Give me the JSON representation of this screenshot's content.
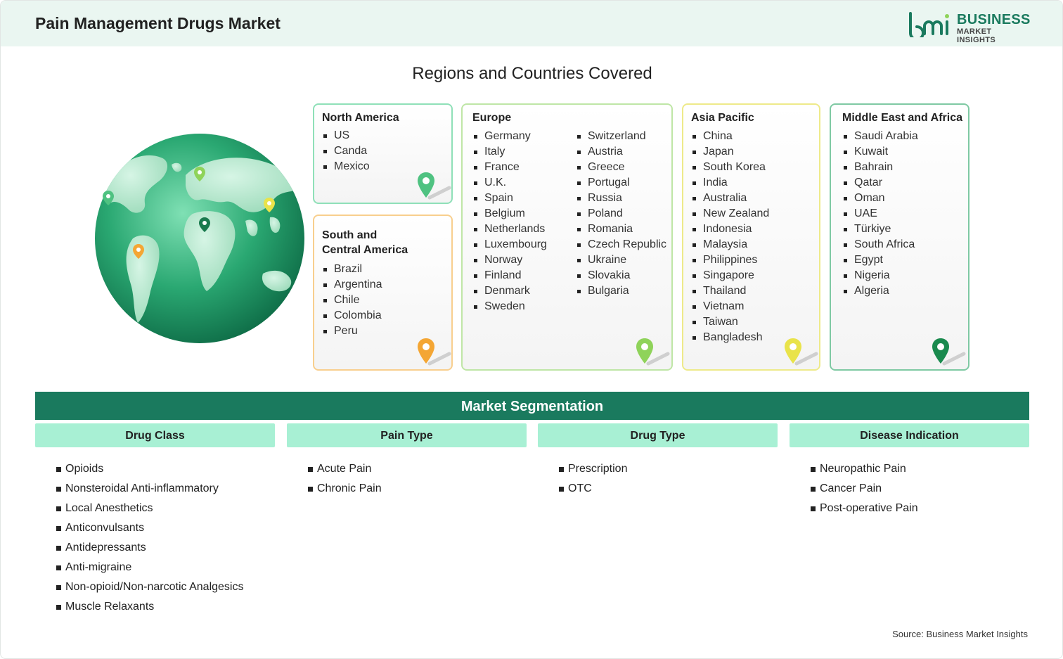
{
  "header": {
    "title": "Pain Management Drugs Market",
    "logo_word1": "BUSINESS",
    "logo_word2": "MARKET INSIGHTS",
    "logo_mark": "bmi"
  },
  "regions": {
    "title": "Regions and Countries Covered",
    "north_america": {
      "title": "North America",
      "color": "#4fc281",
      "items": [
        "US",
        "Canda",
        "Mexico"
      ]
    },
    "south_america": {
      "title_line1": "South and",
      "title_line2": "Central America",
      "color": "#f4a634",
      "items": [
        "Brazil",
        "Argentina",
        "Chile",
        "Colombia",
        "Peru"
      ]
    },
    "europe": {
      "title": "Europe",
      "color": "#8fd35a",
      "col1": [
        "Germany",
        "Italy",
        "France",
        "U.K.",
        "Spain",
        "Belgium",
        "Netherlands",
        "Luxembourg",
        "Norway",
        "Finland",
        "Denmark",
        "Sweden"
      ],
      "col2": [
        "Switzerland",
        "Austria",
        "Greece",
        "Portugal",
        "Russia",
        "Poland",
        "Romania",
        "Czech Republic",
        "Ukraine",
        "Slovakia",
        "Bulgaria"
      ]
    },
    "asia_pacific": {
      "title": "Asia Pacific",
      "color": "#e9e34a",
      "items": [
        "China",
        "Japan",
        "South Korea",
        "India",
        "Australia",
        "New Zealand",
        "Indonesia",
        "Malaysia",
        "Philippines",
        "Singapore",
        "Thailand",
        "Vietnam",
        "Taiwan",
        "Bangladesh"
      ]
    },
    "mea": {
      "title": "Middle East and Africa",
      "color": "#1a8a4e",
      "items": [
        "Saudi Arabia",
        "Kuwait",
        "Bahrain",
        "Qatar",
        "Oman",
        "UAE",
        "Türkiye",
        "South Africa",
        "Egypt",
        "Nigeria",
        "Algeria"
      ]
    }
  },
  "segmentation": {
    "title": "Market Segmentation",
    "columns": [
      {
        "header": "Drug Class",
        "items": [
          "Opioids",
          "Nonsteroidal Anti-inflammatory",
          "Local Anesthetics",
          "Anticonvulsants",
          "Antidepressants",
          "Anti-migraine",
          "Non-opioid/Non-narcotic Analgesics",
          "Muscle Relaxants"
        ]
      },
      {
        "header": "Pain Type",
        "items": [
          "Acute Pain",
          "Chronic Pain"
        ]
      },
      {
        "header": "Drug Type",
        "items": [
          "Prescription",
          "OTC"
        ]
      },
      {
        "header": "Disease Indication",
        "items": [
          "Neuropathic Pain",
          "Cancer Pain",
          "Post-operative Pain"
        ]
      }
    ]
  },
  "source": "Source: Business Market Insights"
}
